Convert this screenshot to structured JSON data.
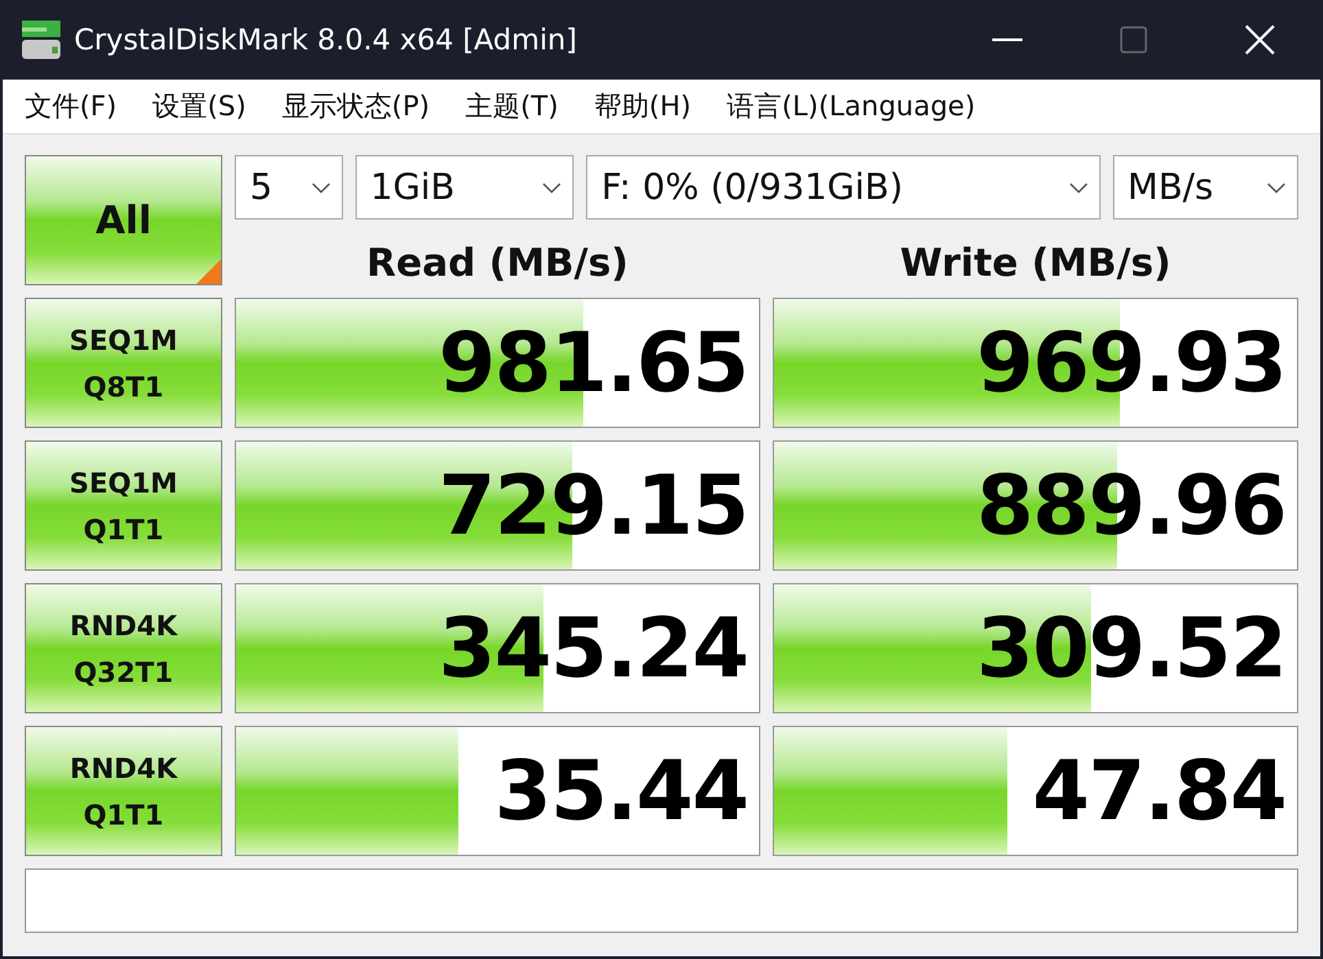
{
  "window": {
    "title": "CrystalDiskMark 8.0.4 x64 [Admin]"
  },
  "menu": [
    "文件(F)",
    "设置(S)",
    "显示状态(P)",
    "主题(T)",
    "帮助(H)",
    "语言(L)(Language)"
  ],
  "all_button": {
    "label": "All"
  },
  "selectors": [
    {
      "value": "5"
    },
    {
      "value": "1GiB"
    },
    {
      "value": "F: 0% (0/931GiB)"
    },
    {
      "value": "MB/s"
    }
  ],
  "headers": {
    "read": "Read (MB/s)",
    "write": "Write (MB/s)"
  },
  "tests": [
    {
      "label_1": "SEQ1M",
      "label_2": "Q8T1",
      "read": {
        "value": "981.65",
        "level": 0.665
      },
      "write": {
        "value": "969.93",
        "level": 0.662
      }
    },
    {
      "label_1": "SEQ1M",
      "label_2": "Q1T1",
      "read": {
        "value": "729.15",
        "level": 0.644
      },
      "write": {
        "value": "889.96",
        "level": 0.657
      }
    },
    {
      "label_1": "RND4K",
      "label_2": "Q32T1",
      "read": {
        "value": "345.24",
        "level": 0.589
      },
      "write": {
        "value": "309.52",
        "level": 0.607
      }
    },
    {
      "label_1": "RND4K",
      "label_2": "Q1T1",
      "read": {
        "value": "35.44",
        "level": 0.424
      },
      "write": {
        "value": "47.84",
        "level": 0.445
      }
    }
  ]
}
